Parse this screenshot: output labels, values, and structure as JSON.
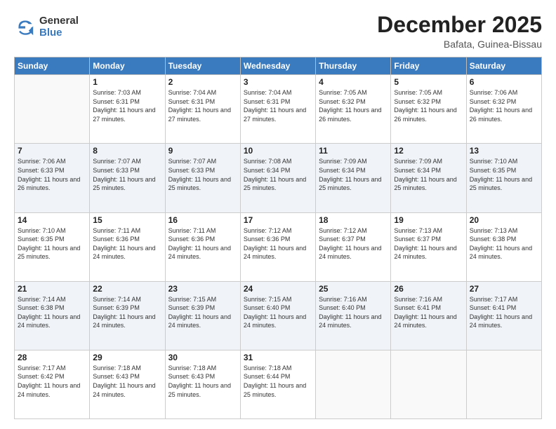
{
  "logo": {
    "general": "General",
    "blue": "Blue"
  },
  "title": "December 2025",
  "subtitle": "Bafata, Guinea-Bissau",
  "days_of_week": [
    "Sunday",
    "Monday",
    "Tuesday",
    "Wednesday",
    "Thursday",
    "Friday",
    "Saturday"
  ],
  "weeks": [
    [
      {
        "day": "",
        "info": ""
      },
      {
        "day": "1",
        "info": "Sunrise: 7:03 AM\nSunset: 6:31 PM\nDaylight: 11 hours and 27 minutes."
      },
      {
        "day": "2",
        "info": "Sunrise: 7:04 AM\nSunset: 6:31 PM\nDaylight: 11 hours and 27 minutes."
      },
      {
        "day": "3",
        "info": "Sunrise: 7:04 AM\nSunset: 6:31 PM\nDaylight: 11 hours and 27 minutes."
      },
      {
        "day": "4",
        "info": "Sunrise: 7:05 AM\nSunset: 6:32 PM\nDaylight: 11 hours and 26 minutes."
      },
      {
        "day": "5",
        "info": "Sunrise: 7:05 AM\nSunset: 6:32 PM\nDaylight: 11 hours and 26 minutes."
      },
      {
        "day": "6",
        "info": "Sunrise: 7:06 AM\nSunset: 6:32 PM\nDaylight: 11 hours and 26 minutes."
      }
    ],
    [
      {
        "day": "7",
        "info": "Sunrise: 7:06 AM\nSunset: 6:33 PM\nDaylight: 11 hours and 26 minutes."
      },
      {
        "day": "8",
        "info": "Sunrise: 7:07 AM\nSunset: 6:33 PM\nDaylight: 11 hours and 25 minutes."
      },
      {
        "day": "9",
        "info": "Sunrise: 7:07 AM\nSunset: 6:33 PM\nDaylight: 11 hours and 25 minutes."
      },
      {
        "day": "10",
        "info": "Sunrise: 7:08 AM\nSunset: 6:34 PM\nDaylight: 11 hours and 25 minutes."
      },
      {
        "day": "11",
        "info": "Sunrise: 7:09 AM\nSunset: 6:34 PM\nDaylight: 11 hours and 25 minutes."
      },
      {
        "day": "12",
        "info": "Sunrise: 7:09 AM\nSunset: 6:34 PM\nDaylight: 11 hours and 25 minutes."
      },
      {
        "day": "13",
        "info": "Sunrise: 7:10 AM\nSunset: 6:35 PM\nDaylight: 11 hours and 25 minutes."
      }
    ],
    [
      {
        "day": "14",
        "info": "Sunrise: 7:10 AM\nSunset: 6:35 PM\nDaylight: 11 hours and 25 minutes."
      },
      {
        "day": "15",
        "info": "Sunrise: 7:11 AM\nSunset: 6:36 PM\nDaylight: 11 hours and 24 minutes."
      },
      {
        "day": "16",
        "info": "Sunrise: 7:11 AM\nSunset: 6:36 PM\nDaylight: 11 hours and 24 minutes."
      },
      {
        "day": "17",
        "info": "Sunrise: 7:12 AM\nSunset: 6:36 PM\nDaylight: 11 hours and 24 minutes."
      },
      {
        "day": "18",
        "info": "Sunrise: 7:12 AM\nSunset: 6:37 PM\nDaylight: 11 hours and 24 minutes."
      },
      {
        "day": "19",
        "info": "Sunrise: 7:13 AM\nSunset: 6:37 PM\nDaylight: 11 hours and 24 minutes."
      },
      {
        "day": "20",
        "info": "Sunrise: 7:13 AM\nSunset: 6:38 PM\nDaylight: 11 hours and 24 minutes."
      }
    ],
    [
      {
        "day": "21",
        "info": "Sunrise: 7:14 AM\nSunset: 6:38 PM\nDaylight: 11 hours and 24 minutes."
      },
      {
        "day": "22",
        "info": "Sunrise: 7:14 AM\nSunset: 6:39 PM\nDaylight: 11 hours and 24 minutes."
      },
      {
        "day": "23",
        "info": "Sunrise: 7:15 AM\nSunset: 6:39 PM\nDaylight: 11 hours and 24 minutes."
      },
      {
        "day": "24",
        "info": "Sunrise: 7:15 AM\nSunset: 6:40 PM\nDaylight: 11 hours and 24 minutes."
      },
      {
        "day": "25",
        "info": "Sunrise: 7:16 AM\nSunset: 6:40 PM\nDaylight: 11 hours and 24 minutes."
      },
      {
        "day": "26",
        "info": "Sunrise: 7:16 AM\nSunset: 6:41 PM\nDaylight: 11 hours and 24 minutes."
      },
      {
        "day": "27",
        "info": "Sunrise: 7:17 AM\nSunset: 6:41 PM\nDaylight: 11 hours and 24 minutes."
      }
    ],
    [
      {
        "day": "28",
        "info": "Sunrise: 7:17 AM\nSunset: 6:42 PM\nDaylight: 11 hours and 24 minutes."
      },
      {
        "day": "29",
        "info": "Sunrise: 7:18 AM\nSunset: 6:43 PM\nDaylight: 11 hours and 24 minutes."
      },
      {
        "day": "30",
        "info": "Sunrise: 7:18 AM\nSunset: 6:43 PM\nDaylight: 11 hours and 25 minutes."
      },
      {
        "day": "31",
        "info": "Sunrise: 7:18 AM\nSunset: 6:44 PM\nDaylight: 11 hours and 25 minutes."
      },
      {
        "day": "",
        "info": ""
      },
      {
        "day": "",
        "info": ""
      },
      {
        "day": "",
        "info": ""
      }
    ]
  ]
}
